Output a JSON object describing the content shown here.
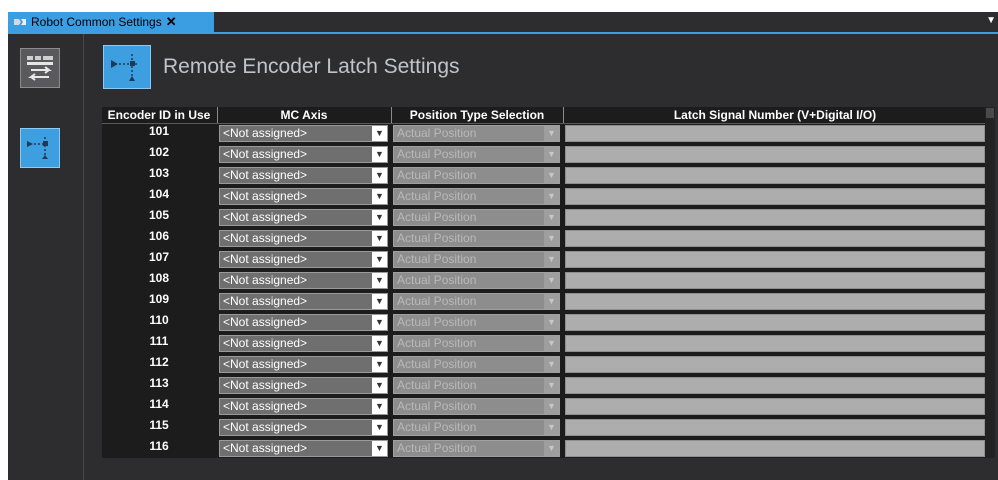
{
  "tab": {
    "title": "Robot Common Settings",
    "close": "✕"
  },
  "page": {
    "title": "Remote Encoder Latch Settings"
  },
  "table": {
    "columns": [
      "Encoder ID in Use",
      "MC Axis",
      "Position Type Selection",
      "Latch Signal Number (V+Digital I/O)"
    ],
    "rows": [
      {
        "id": "101",
        "mc_axis": "<Not assigned>",
        "position_type": "Actual Position"
      },
      {
        "id": "102",
        "mc_axis": "<Not assigned>",
        "position_type": "Actual Position"
      },
      {
        "id": "103",
        "mc_axis": "<Not assigned>",
        "position_type": "Actual Position"
      },
      {
        "id": "104",
        "mc_axis": "<Not assigned>",
        "position_type": "Actual Position"
      },
      {
        "id": "105",
        "mc_axis": "<Not assigned>",
        "position_type": "Actual Position"
      },
      {
        "id": "106",
        "mc_axis": "<Not assigned>",
        "position_type": "Actual Position"
      },
      {
        "id": "107",
        "mc_axis": "<Not assigned>",
        "position_type": "Actual Position"
      },
      {
        "id": "108",
        "mc_axis": "<Not assigned>",
        "position_type": "Actual Position"
      },
      {
        "id": "109",
        "mc_axis": "<Not assigned>",
        "position_type": "Actual Position"
      },
      {
        "id": "110",
        "mc_axis": "<Not assigned>",
        "position_type": "Actual Position"
      },
      {
        "id": "111",
        "mc_axis": "<Not assigned>",
        "position_type": "Actual Position"
      },
      {
        "id": "112",
        "mc_axis": "<Not assigned>",
        "position_type": "Actual Position"
      },
      {
        "id": "113",
        "mc_axis": "<Not assigned>",
        "position_type": "Actual Position"
      },
      {
        "id": "114",
        "mc_axis": "<Not assigned>",
        "position_type": "Actual Position"
      },
      {
        "id": "115",
        "mc_axis": "<Not assigned>",
        "position_type": "Actual Position"
      },
      {
        "id": "116",
        "mc_axis": "<Not assigned>",
        "position_type": "Actual Position"
      }
    ]
  },
  "icons": {
    "tab": "robot-tab-icon",
    "sidebar": [
      "axis-mapping-icon",
      "encoder-latch-icon"
    ],
    "header": "encoder-latch-icon"
  },
  "colors": {
    "accent": "#3d9ee0",
    "background": "#2d2d30",
    "grid": "#1c1c1c"
  }
}
